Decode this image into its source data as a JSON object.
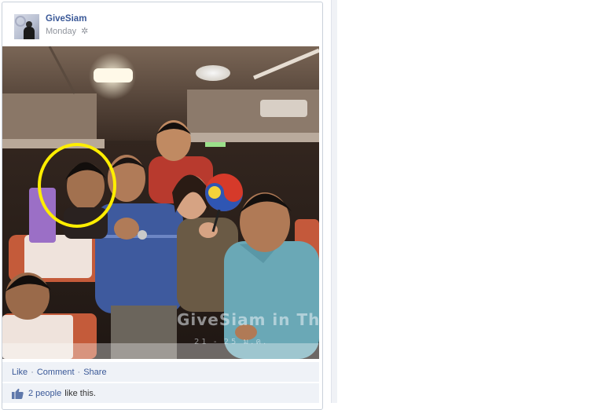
{
  "post": {
    "page_name": "GiveSiam",
    "timestamp": "Monday",
    "audience_icon": "gear-icon"
  },
  "photo": {
    "watermark": "GiveSiam in Thai",
    "date_overlay": "21 - 25 ม.ค."
  },
  "actions": {
    "like": "Like",
    "comment": "Comment",
    "share": "Share",
    "separator": "·"
  },
  "likes": {
    "count_label": "2 people",
    "suffix": "like this.",
    "icon": "thumbs-up-icon"
  },
  "colors": {
    "link": "#3b5998",
    "bar_bg": "#eff2f7",
    "highlight_circle": "#ffee00"
  }
}
